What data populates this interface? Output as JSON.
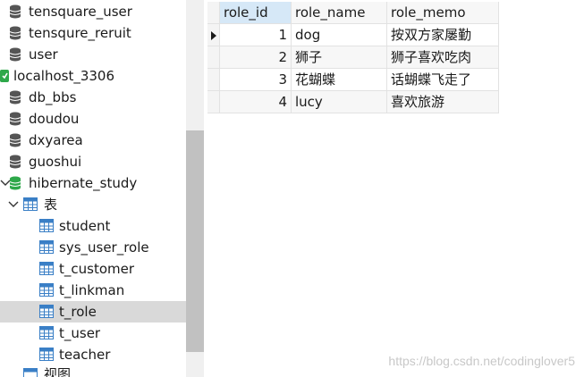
{
  "sidebar": {
    "items": [
      {
        "label": "tensquare_user",
        "type": "database",
        "status": "closed"
      },
      {
        "label": "tensqure_reruit",
        "type": "database",
        "status": "closed"
      },
      {
        "label": "user",
        "type": "database",
        "status": "closed"
      },
      {
        "label": "localhost_3306",
        "type": "connection",
        "status": "open"
      },
      {
        "label": "db_bbs",
        "type": "database",
        "status": "closed"
      },
      {
        "label": "doudou",
        "type": "database",
        "status": "closed"
      },
      {
        "label": "dxyarea",
        "type": "database",
        "status": "closed"
      },
      {
        "label": "guoshui",
        "type": "database",
        "status": "closed"
      },
      {
        "label": "hibernate_study",
        "type": "database",
        "status": "open"
      },
      {
        "label": "表",
        "type": "folder",
        "status": "expanded"
      },
      {
        "label": "student",
        "type": "table"
      },
      {
        "label": "sys_user_role",
        "type": "table"
      },
      {
        "label": "t_customer",
        "type": "table"
      },
      {
        "label": "t_linkman",
        "type": "table"
      },
      {
        "label": "t_role",
        "type": "table",
        "selected": true
      },
      {
        "label": "t_user",
        "type": "table"
      },
      {
        "label": "teacher",
        "type": "table"
      },
      {
        "label": "视图",
        "type": "folder"
      }
    ]
  },
  "grid": {
    "columns": [
      "role_id",
      "role_name",
      "role_memo"
    ],
    "rows": [
      {
        "role_id": "1",
        "role_name": "dog",
        "role_memo": "按双方家屡勤"
      },
      {
        "role_id": "2",
        "role_name": "狮子",
        "role_memo": "狮子喜欢吃肉"
      },
      {
        "role_id": "3",
        "role_name": "花蝴蝶",
        "role_memo": "话蝴蝶飞走了"
      },
      {
        "role_id": "4",
        "role_name": "lucy",
        "role_memo": "喜欢旅游"
      }
    ],
    "current_row": 0
  },
  "watermark": "https://blog.csdn.net/codinglover5",
  "colors": {
    "db_closed": "#555555",
    "db_open": "#2ea84a",
    "connection": "#2ea84a",
    "table_icon": "#3a7fc6",
    "selection": "#d9d9d9",
    "header_active": "#d6e8f7"
  }
}
